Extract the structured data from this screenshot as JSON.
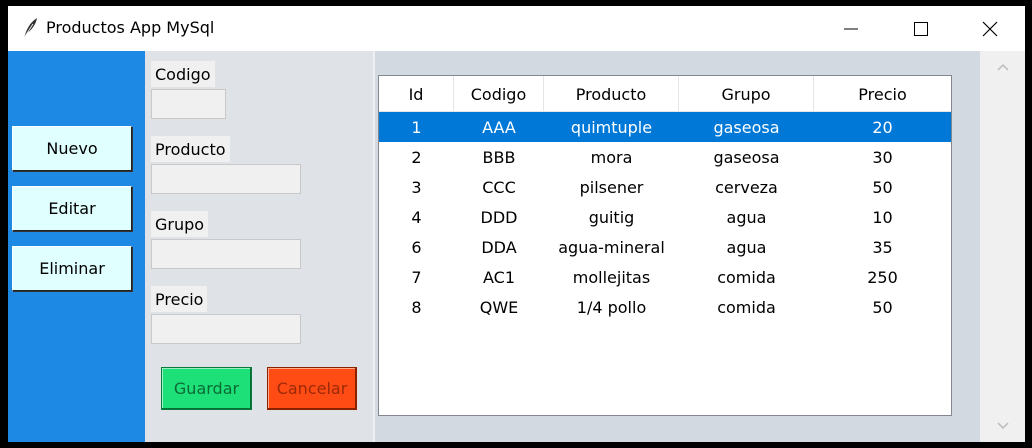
{
  "window": {
    "title": "Productos App MySql"
  },
  "sidebar": {
    "nuevo_label": "Nuevo",
    "editar_label": "Editar",
    "eliminar_label": "Eliminar"
  },
  "form": {
    "codigo_label": "Codigo",
    "codigo_value": "",
    "producto_label": "Producto",
    "producto_value": "",
    "grupo_label": "Grupo",
    "grupo_value": "",
    "precio_label": "Precio",
    "precio_value": "",
    "guardar_label": "Guardar",
    "cancelar_label": "Cancelar"
  },
  "table": {
    "columns": [
      "Id",
      "Codigo",
      "Producto",
      "Grupo",
      "Precio"
    ],
    "selected_row": 0,
    "rows": [
      [
        "1",
        "AAA",
        "quimtuple",
        "gaseosa",
        "20"
      ],
      [
        "2",
        "BBB",
        "mora",
        "gaseosa",
        "30"
      ],
      [
        "3",
        "CCC",
        "pilsener",
        "cerveza",
        "50"
      ],
      [
        "4",
        "DDD",
        "guitig",
        "agua",
        "10"
      ],
      [
        "6",
        "DDA",
        "agua-mineral",
        "agua",
        "35"
      ],
      [
        "7",
        "AC1",
        "mollejitas",
        "comida",
        "250"
      ],
      [
        "8",
        "QWE",
        "1/4 pollo",
        "comida",
        "50"
      ]
    ]
  },
  "colors": {
    "sidebar": "#1e88e5",
    "selection": "#0078d7",
    "guardar": "#1ee078",
    "cancelar": "#ff4b14"
  }
}
